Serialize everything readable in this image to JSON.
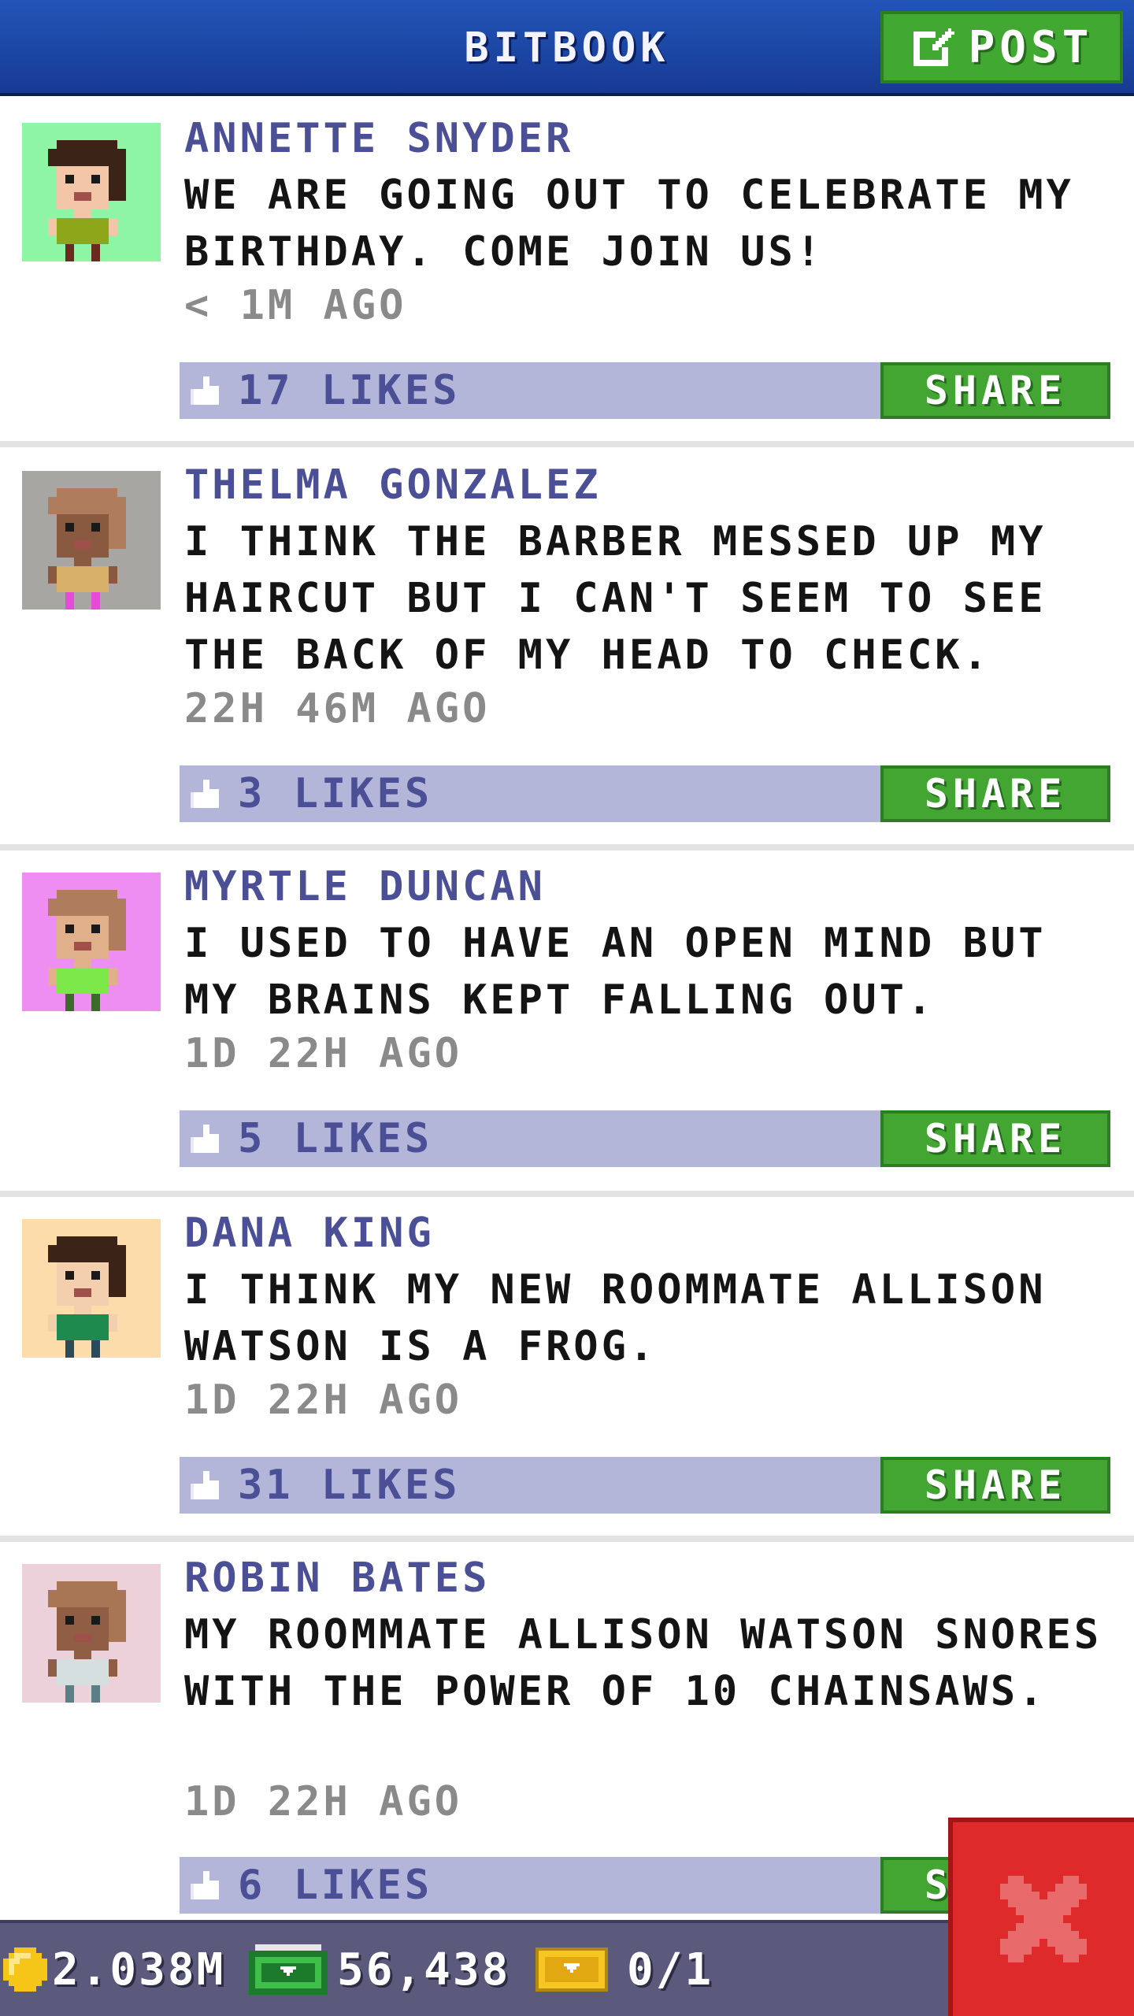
{
  "header": {
    "title": "BITBOOK",
    "post_label": "POST"
  },
  "posts": [
    {
      "author": "ANNETTE SNYDER",
      "message": "WE ARE GOING OUT TO CELEBRATE MY BIRTHDAY. COME JOIN US!",
      "time": "< 1M AGO",
      "likes": "17 LIKES",
      "share_label": "SHARE",
      "avatar_bg": "#8ef5a4",
      "hair": "#3b2417",
      "skin": "#f2c6a6",
      "shirt": "#8ea71a",
      "legs": "#6b2a1e"
    },
    {
      "author": "THELMA GONZALEZ",
      "message": "I THINK THE BARBER MESSED UP MY HAIRCUT BUT I CAN'T SEEM TO SEE THE BACK OF MY HEAD TO CHECK.",
      "time": "22H 46M AGO",
      "likes": "3 LIKES",
      "share_label": "SHARE",
      "avatar_bg": "#a8a6a2",
      "hair": "#b07c5e",
      "skin": "#8a5a40",
      "shirt": "#d8b06a",
      "legs": "#e54bd6"
    },
    {
      "author": "MYRTLE DUNCAN",
      "message": "I USED TO HAVE AN OPEN MIND BUT MY BRAINS KEPT FALLING OUT.",
      "time": "1D 22H AGO",
      "likes": "5 LIKES",
      "share_label": "SHARE",
      "avatar_bg": "#ee8ef3",
      "hair": "#b07c5e",
      "skin": "#e0b08a",
      "shirt": "#7de84a",
      "legs": "#3b6a2a"
    },
    {
      "author": "DANA KING",
      "message": "I THINK MY NEW ROOMMATE ALLISON WATSON IS A FROG.",
      "time": "1D 22H AGO",
      "likes": "31 LIKES",
      "share_label": "SHARE",
      "avatar_bg": "#fddcac",
      "hair": "#3b2417",
      "skin": "#f4cfae",
      "shirt": "#1f8a4e",
      "legs": "#2b4a5a"
    },
    {
      "author": "ROBIN BATES",
      "message": "MY ROOMMATE ALLISON WATSON SNORES WITH THE POWER OF 10 CHAINSAWS.",
      "time": "1D 22H AGO",
      "likes": "6 LIKES",
      "share_label": "SHARE",
      "avatar_bg": "#ecd0da",
      "hair": "#a87654",
      "skin": "#8f5e44",
      "shirt": "#d6dfe0",
      "legs": "#5a7f84"
    }
  ],
  "status_bar": {
    "coins": "2.038M",
    "cash": "56,438",
    "tickets": "0/1"
  },
  "colors": {
    "header_blue": "#1e4aa8",
    "share_green": "#43a632",
    "likes_bar": "#b3b6d8",
    "author_purple": "#4b4f96",
    "close_red": "#de2a2a"
  },
  "icons": {
    "post": "compose-icon",
    "like": "thumbs-up-icon",
    "coin": "coin-icon",
    "cash": "cash-icon",
    "ticket": "ticket-icon",
    "close": "close-icon"
  }
}
